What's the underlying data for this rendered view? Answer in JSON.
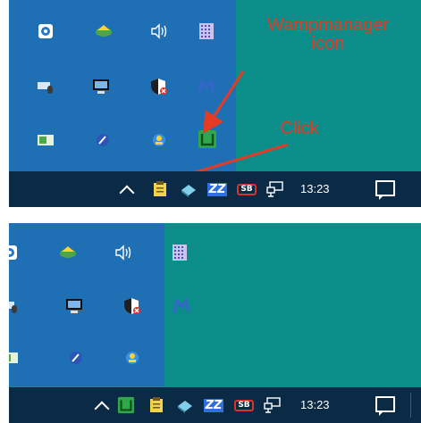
{
  "colors": {
    "desktop": "#0b8d8a",
    "tray_popup": "#1f6fb5",
    "taskbar": "#0b2a45",
    "annotation": "#e53b24",
    "wamp_green": "#2fa84a",
    "shield_red": "#d9342b",
    "text": "#ffffff"
  },
  "top": {
    "annotation_wamp": "Wampmanager\nicon",
    "annotation_click": "Click",
    "tray_icons": [
      "security-app-icon",
      "network-globe-icon",
      "volume-icon",
      "grid-app-icon",
      "keyboard-mouse-icon",
      "monitor-icon",
      "shield-error-icon",
      "malwarebytes-icon",
      "display-settings-icon",
      "pen-tablet-icon",
      "user-sync-icon",
      "wampmanager-icon"
    ],
    "taskbar": {
      "chevron": "show-hidden-icons",
      "icons": [
        "clipboard-icon",
        "storage-icon",
        "zend-icon",
        "sb-icon",
        "network-icon"
      ],
      "sb_label": "SB",
      "zend_label": "ZZ",
      "clock": "13:23"
    }
  },
  "bottom": {
    "tray_icons": [
      "security-app-icon",
      "network-globe-icon",
      "volume-icon",
      "grid-app-icon",
      "keyboard-mouse-icon",
      "monitor-icon",
      "shield-error-icon",
      "malwarebytes-icon",
      "display-settings-icon",
      "pen-tablet-icon",
      "user-sync-icon"
    ],
    "taskbar": {
      "chevron": "show-hidden-icons",
      "icons": [
        "wampmanager-icon",
        "clipboard-icon",
        "storage-icon",
        "zend-icon",
        "sb-icon",
        "network-icon"
      ],
      "sb_label": "SB",
      "zend_label": "ZZ",
      "clock": "13:23"
    }
  }
}
